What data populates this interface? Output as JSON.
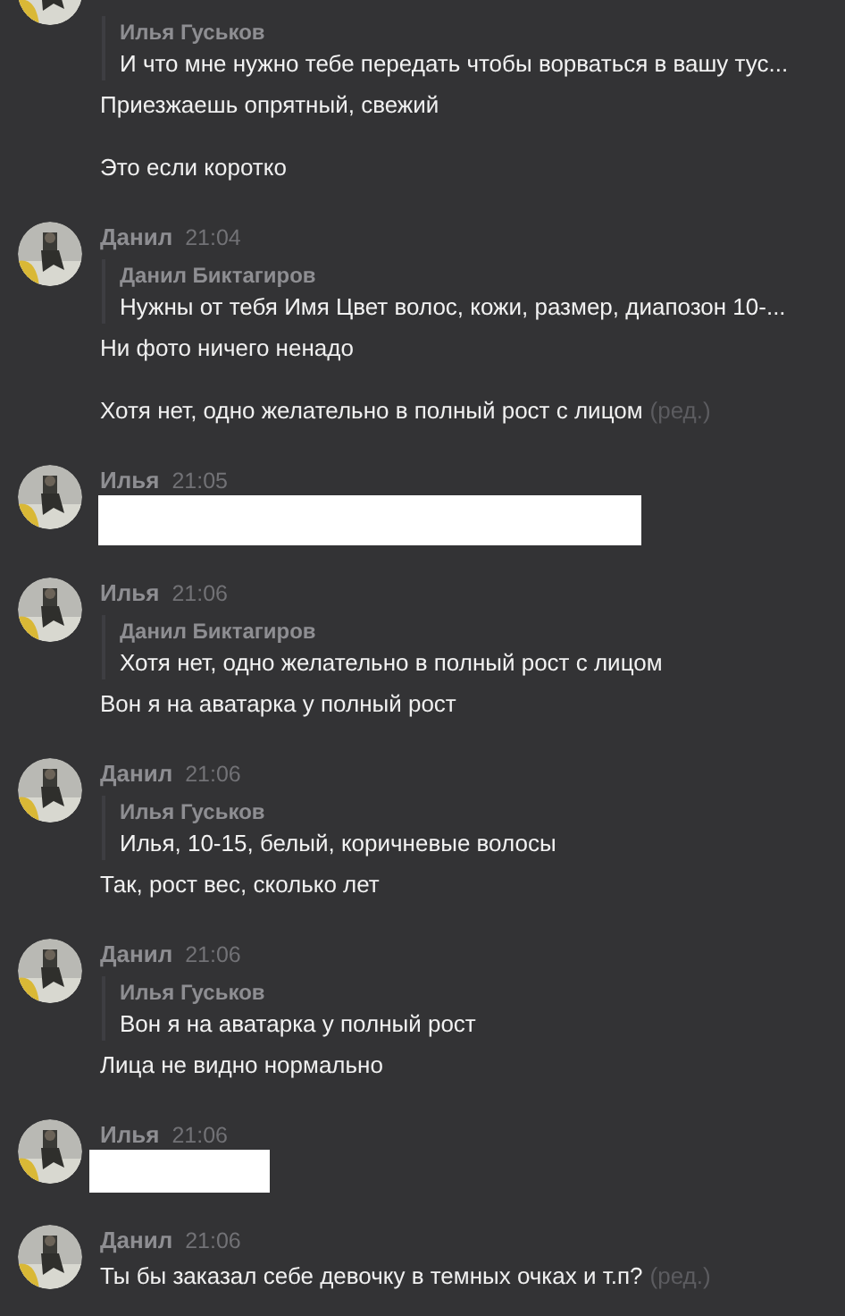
{
  "messages": [
    {
      "items": [
        {
          "kind": "quote",
          "author": "Илья Гуськов",
          "text": "И что мне нужно тебе передать чтобы ворваться в вашу тус..."
        },
        {
          "kind": "text",
          "text": "Приезжаешь опрятный, свежий"
        },
        {
          "kind": "text",
          "text": "Это если коротко"
        }
      ]
    },
    {
      "author": "Данил",
      "time": "21:04",
      "items": [
        {
          "kind": "quote",
          "author": "Данил Биктагиров",
          "text": "Нужны от тебя Имя Цвет волос, кожи, размер, диапозон 10-..."
        },
        {
          "kind": "text",
          "text": "Ни фото ничего ненадо"
        },
        {
          "kind": "text",
          "text": "Хотя нет, одно желательно в полный рост с лицом",
          "edited_label": "(ред.)"
        }
      ]
    },
    {
      "author": "Илья",
      "time": "21:05",
      "items": [
        {
          "kind": "redacted"
        }
      ]
    },
    {
      "author": "Илья",
      "time": "21:06",
      "items": [
        {
          "kind": "quote",
          "author": "Данил Биктагиров",
          "text": "Хотя нет, одно желательно в полный рост с лицом"
        },
        {
          "kind": "text",
          "text": "Вон я на аватарка у полный рост"
        }
      ]
    },
    {
      "author": "Данил",
      "time": "21:06",
      "items": [
        {
          "kind": "quote",
          "author": "Илья Гуськов",
          "text": "Илья, 10-15, белый, коричневые волосы"
        },
        {
          "kind": "text",
          "text": "Так, рост вес, сколько лет"
        }
      ]
    },
    {
      "author": "Данил",
      "time": "21:06",
      "items": [
        {
          "kind": "quote",
          "author": "Илья Гуськов",
          "text": "Вон я на аватарка у полный рост"
        },
        {
          "kind": "text",
          "text": "Лица не видно нормально"
        }
      ]
    },
    {
      "author": "Илья",
      "time": "21:06",
      "items": [
        {
          "kind": "redacted"
        }
      ]
    },
    {
      "author": "Данил",
      "time": "21:06",
      "items": [
        {
          "kind": "text",
          "text": "Ты бы заказал себе девочку в темных очках и т.п?",
          "edited_label": "(ред.)"
        }
      ]
    }
  ]
}
